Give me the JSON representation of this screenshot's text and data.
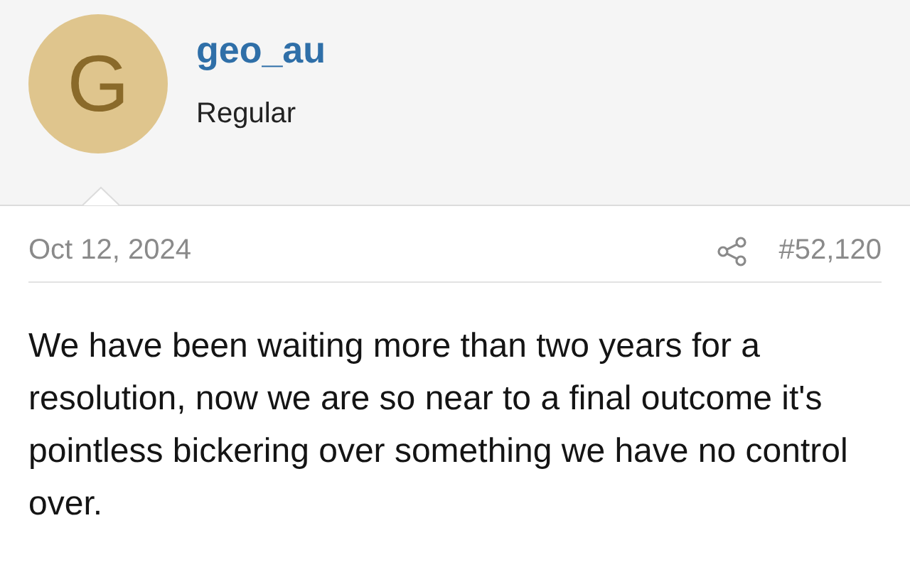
{
  "user": {
    "initial": "G",
    "name": "geo_au",
    "role": "Regular"
  },
  "post": {
    "date": "Oct 12, 2024",
    "number": "#52,120",
    "body": "We have been waiting more than two years for a resolution, now we are so near to a final outcome it's pointless bickering over something we have no control over."
  }
}
